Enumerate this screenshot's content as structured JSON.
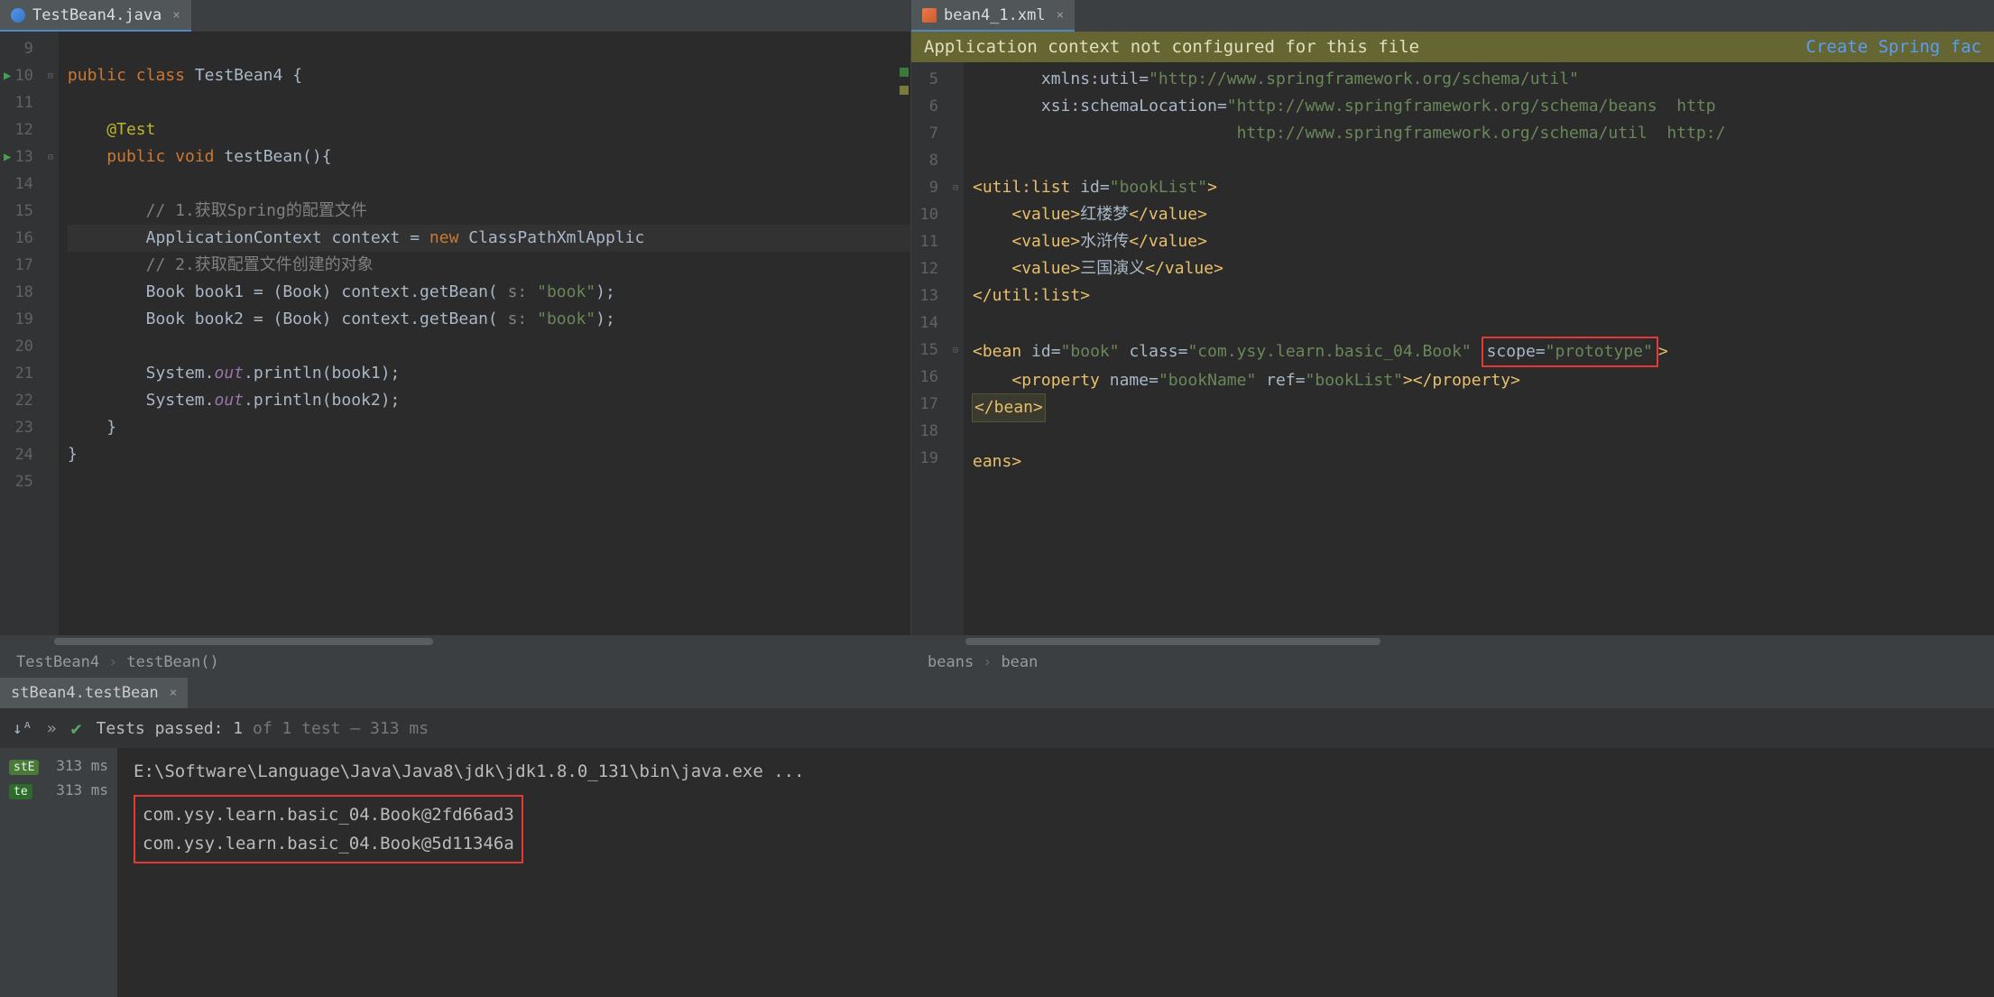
{
  "left_editor": {
    "tab": {
      "filename": "TestBean4.java",
      "active": true
    },
    "lines": {
      "9": "",
      "10": "public class TestBean4 {",
      "11": "",
      "12": "    @Test",
      "13": "    public void testBean(){",
      "14": "",
      "15": "        // 1.获取Spring的配置文件",
      "16": "        ApplicationContext context = new ClassPathXmlApplic",
      "17": "        // 2.获取配置文件创建的对象",
      "18_pre": "        Book book1 = (Book) context.getBean(",
      "18_param": " s: ",
      "18_str": "\"book\"",
      "18_post": ");",
      "19_pre": "        Book book2 = (Book) context.getBean(",
      "19_param": " s: ",
      "19_str": "\"book\"",
      "19_post": ");",
      "20": "",
      "21_pre": "        System.",
      "21_out": "out",
      "21_post": ".println(book1);",
      "22_pre": "        System.",
      "22_out": "out",
      "22_post": ".println(book2);",
      "23": "    }",
      "24": "}",
      "25": ""
    },
    "gutter": [
      "9",
      "10",
      "11",
      "12",
      "13",
      "14",
      "15",
      "16",
      "17",
      "18",
      "19",
      "20",
      "21",
      "22",
      "23",
      "24",
      "25"
    ],
    "crumb1": "TestBean4",
    "crumb2": "testBean()"
  },
  "right_editor": {
    "tab": {
      "filename": "bean4_1.xml"
    },
    "banner_text": "Application context not configured for this file",
    "banner_link": "Create Spring fac",
    "gutter": [
      "5",
      "6",
      "7",
      "8",
      "9",
      "10",
      "11",
      "12",
      "13",
      "14",
      "15",
      "16",
      "17",
      "18",
      "19"
    ],
    "xmlns_util": "       xmlns:util=\"http://www.springframework.org/schema/util\"",
    "xsi1": "       xsi:schemaLocation=\"http://www.springframework.org/schema/beans  http",
    "xsi2": "                           http://www.springframework.org/schema/util  http:/",
    "utillist_open": "<util:list id=\"bookList\">",
    "val1": "    <value>红楼梦</value>",
    "val2": "    <value>水浒传</value>",
    "val3": "    <value>三国演义</value>",
    "utillist_close": "</util:list>",
    "bean_open_pre": "<bean id=\"book\" class=\"com.ysy.learn.basic_04.Book\" ",
    "bean_open_scope": "scope=\"prototype\"",
    "bean_open_post": ">",
    "property": "    <property name=\"bookName\" ref=\"bookList\"></property>",
    "bean_close": "</bean>",
    "beans_close": "eans>",
    "crumb1": "beans",
    "crumb2": "bean"
  },
  "bottom": {
    "tab": "stBean4.testBean",
    "tests_passed": "Tests passed: 1",
    "tests_rest": " of 1 test – 313 ms",
    "tree": [
      {
        "label": "stE",
        "time": "313 ms"
      },
      {
        "label": "te",
        "time": "313 ms"
      }
    ],
    "cmd": "E:\\Software\\Language\\Java\\Java8\\jdk\\jdk1.8.0_131\\bin\\java.exe ...",
    "out1": "com.ysy.learn.basic_04.Book@2fd66ad3",
    "out2": "com.ysy.learn.basic_04.Book@5d11346a"
  }
}
